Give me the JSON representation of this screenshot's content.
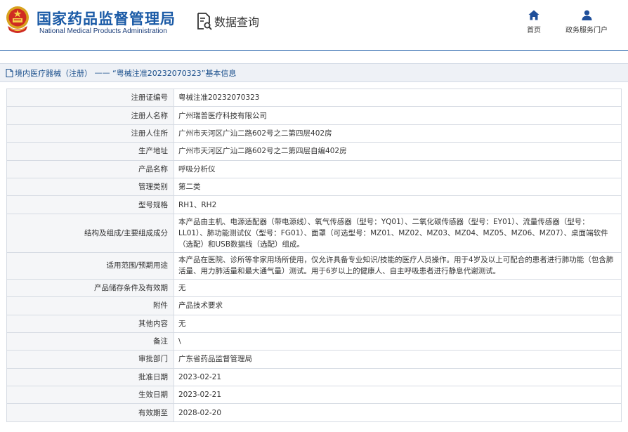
{
  "header": {
    "brand_cn": "国家药品监督管理局",
    "brand_en": "National Medical Products Administration",
    "search_title": "数据查询",
    "nav": {
      "home_label": "首页",
      "service_label": "政务服务门户"
    }
  },
  "breadcrumb": {
    "category": "境内医疗器械（注册）",
    "separator": " —— ",
    "current": "“粤械注准20232070323”基本信息"
  },
  "detail": {
    "rows": [
      {
        "label": "注册证编号",
        "value": "粤械注准20232070323"
      },
      {
        "label": "注册人名称",
        "value": "广州瑞普医疗科技有限公司"
      },
      {
        "label": "注册人住所",
        "value": "广州市天河区广汕二路602号之二第四层402房"
      },
      {
        "label": "生产地址",
        "value": "广州市天河区广汕二路602号之二第四层自编402房"
      },
      {
        "label": "产品名称",
        "value": "呼吸分析仪"
      },
      {
        "label": "管理类别",
        "value": "第二类"
      },
      {
        "label": "型号规格",
        "value": "RH1、RH2"
      },
      {
        "label": "结构及组成/主要组成成分",
        "value": "本产品由主机、电源适配器（带电源线）、氧气传感器（型号：YQ01）、二氧化碳传感器（型号：EY01）、流量传感器（型号：LL01）、肺功能测试仪（型号：FG01）、面罩（可选型号：MZ01、MZ02、MZ03、MZ04、MZ05、MZ06、MZ07）、桌面端软件（选配）和USB数据线（选配）组成。"
      },
      {
        "label": "适用范围/预期用途",
        "value": "本产品在医院、诊所等非家用场所使用，仅允许具备专业知识/技能的医疗人员操作。用于4岁及以上可配合的患者进行肺功能（包含肺活量、用力肺活量和最大通气量）测试。用于6岁以上的健康人、自主呼吸患者进行静息代谢测试。"
      },
      {
        "label": "产品储存条件及有效期",
        "value": "无"
      },
      {
        "label": "附件",
        "value": "产品技术要求"
      },
      {
        "label": "其他内容",
        "value": "无"
      },
      {
        "label": "备注",
        "value": "\\"
      },
      {
        "label": "审批部门",
        "value": "广东省药品监督管理局"
      },
      {
        "label": "批准日期",
        "value": "2023-02-21"
      },
      {
        "label": "生效日期",
        "value": "2023-02-21"
      },
      {
        "label": "有效期至",
        "value": "2028-02-20"
      }
    ]
  },
  "colors": {
    "brand_blue": "#1a5aa6",
    "nav_icon_blue": "#1f4f9a",
    "label_bg": "#f5f6f8",
    "border": "#d6dbe3",
    "breadcrumb_bg": "#eef1f6"
  },
  "icons": {
    "emblem": "national-emblem-icon",
    "search": "document-search-icon",
    "home": "home-icon",
    "service": "user-icon",
    "breadcrumb": "document-icon"
  }
}
